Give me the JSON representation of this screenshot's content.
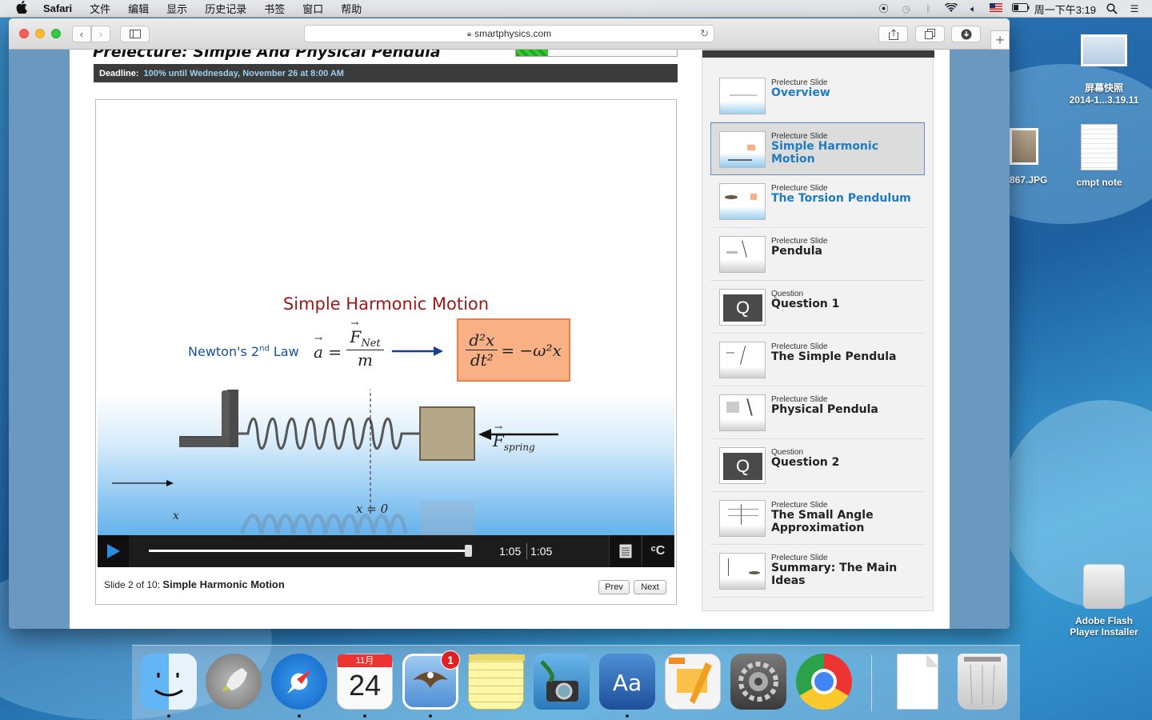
{
  "menubar": {
    "app": "Safari",
    "menus": [
      "文件",
      "编辑",
      "显示",
      "历史记录",
      "书签",
      "窗口",
      "帮助"
    ],
    "clock": "周一下午3:19"
  },
  "browser": {
    "url": "smartphysics.com"
  },
  "page": {
    "lecture_title": "Prelecture: Simple And Physical Pendula",
    "progress_fraction": 0.2,
    "deadline_label": "Deadline:",
    "deadline_value": "100% until Wednesday, November 26 at 8:00 AM"
  },
  "slide": {
    "title": "Simple Harmonic Motion",
    "newton_label": "Newton's 2",
    "newton_sup": "nd",
    "newton_suffix": " Law",
    "eq_lhs": "a",
    "eq_num": "F",
    "eq_num_sub": "Net",
    "eq_den": "m",
    "box_num": "d²x",
    "box_den": "dt²",
    "box_rhs": "= −ω²x",
    "fspring": "F",
    "fspring_sub": "spring",
    "xzero": "x = 0",
    "xaxis": "x"
  },
  "controls": {
    "progress_fraction": 1.0,
    "current_time": "1:05",
    "total_time": "1:05"
  },
  "footer": {
    "slide_prefix": "Slide 2 of 10:",
    "slide_name": "Simple Harmonic Motion",
    "prev": "Prev",
    "next": "Next"
  },
  "sidebar": {
    "items": [
      {
        "kind": "Prelecture Slide",
        "title": "Overview",
        "type": "slide",
        "blue": true
      },
      {
        "kind": "Prelecture Slide",
        "title": "Simple Harmonic Motion",
        "type": "slide",
        "blue": true
      },
      {
        "kind": "Prelecture Slide",
        "title": "The Torsion Pendulum",
        "type": "slide",
        "blue": true
      },
      {
        "kind": "Prelecture Slide",
        "title": "Pendula",
        "type": "slide",
        "blue": false
      },
      {
        "kind": "Question",
        "title": "Question 1",
        "type": "question",
        "blue": false
      },
      {
        "kind": "Prelecture Slide",
        "title": "The Simple Pendula",
        "type": "slide",
        "blue": false
      },
      {
        "kind": "Prelecture Slide",
        "title": "Physical Pendula",
        "type": "slide",
        "blue": false
      },
      {
        "kind": "Question",
        "title": "Question 2",
        "type": "question",
        "blue": false
      },
      {
        "kind": "Prelecture Slide",
        "title": "The Small Angle Approximation",
        "type": "slide",
        "blue": false
      },
      {
        "kind": "Prelecture Slide",
        "title": "Summary: The Main Ideas",
        "type": "slide",
        "blue": false
      }
    ]
  },
  "desktop": {
    "screenshot_label_1": "屏幕快照",
    "screenshot_label_2": "2014-1...3.19.11",
    "jpg_label": "867.JPG",
    "note_label": "cmpt note",
    "installer_label_1": "Adobe Flash",
    "installer_label_2": "Player Installer"
  },
  "dock": {
    "calendar_month": "11月",
    "calendar_day": "24",
    "mail_badge": "1"
  }
}
